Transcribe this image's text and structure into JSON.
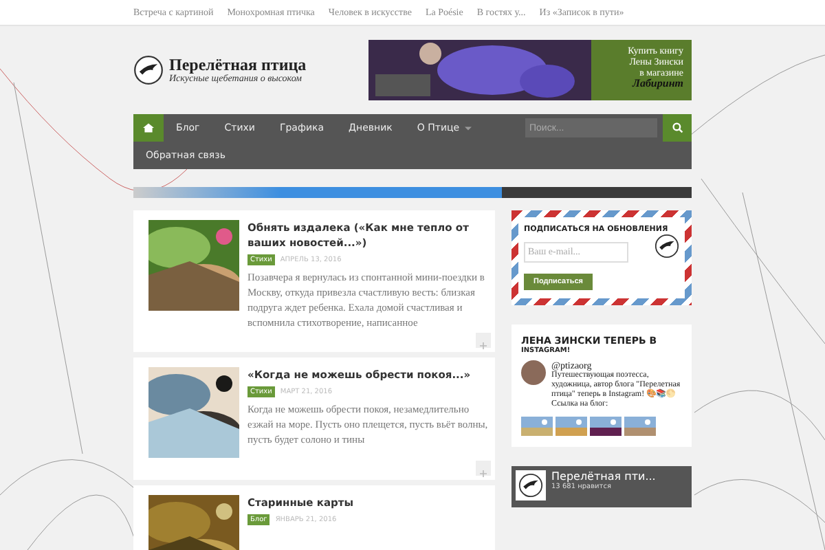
{
  "top_links": [
    "Встреча с картиной",
    "Монохромная птичка",
    "Человек в искусстве",
    "La Poésie",
    "В гостях у...",
    "Из «Записок в пути»"
  ],
  "logo": {
    "title": "Перелётная птица",
    "tagline": "Искусные щебетания о высоком"
  },
  "banner": {
    "lines": [
      "Купить книгу",
      "Лены Зински",
      "в магазине"
    ],
    "shop": "Лабиринт"
  },
  "nav": [
    {
      "label": "Блог",
      "selected": false,
      "dropdown": false
    },
    {
      "label": "Стихи",
      "selected": false,
      "dropdown": false
    },
    {
      "label": "Графика",
      "selected": false,
      "dropdown": false
    },
    {
      "label": "Дневник",
      "selected": false,
      "dropdown": false
    },
    {
      "label": "О Птице",
      "selected": false,
      "dropdown": true
    },
    {
      "label": "Обратная связь",
      "selected": false,
      "dropdown": false
    }
  ],
  "search": {
    "placeholder": "Поиск..."
  },
  "progress": {
    "level": 0.66
  },
  "posts": [
    {
      "title": "Обнять издалека («Как мне тепло от ваших новостей...»)",
      "tag": "Стихи",
      "date": "АПРЕЛЬ 13, 2016",
      "excerpt": "Позавчера я вернулась из спонтанной мини-поездки в Москву, откуда привезла счастливую весть: близкая подруга ждет ребенка. Ехала домой счастливая и вспомнила стихотворение, написанное"
    },
    {
      "title": "«Когда не можешь обрести покоя...»",
      "tag": "Стихи",
      "date": "МАРТ 21, 2016",
      "excerpt": "Когда не можешь обрести покоя, незамедлительно езжай на море. Пусть оно плещется, пусть вьёт волны, пусть будет солоно и тины"
    },
    {
      "title": "Старинные карты",
      "tag": "Блог",
      "date": "ЯНВАРЬ 21, 2016"
    }
  ],
  "subscribe": {
    "title": "ПОДПИСАТЬСЯ НА ОБНОВЛЕНИЯ",
    "placeholder": "Ваш e-mail...",
    "button": "Подписаться"
  },
  "instagram": {
    "title": "ЛЕНА ЗИНСКИ ТЕПЕРЬ В",
    "title2": "INSTAGRAM!",
    "user": "@ptizaorg",
    "bio": "Путешествующая поэтесса, художница, автор блога \"Перелетная птица\" теперь в Instagram! 🎨📚🌕 Ссылка на блог:"
  },
  "facebook": {
    "name": "Перелётная пти...",
    "likes": "13 681 нравится"
  }
}
